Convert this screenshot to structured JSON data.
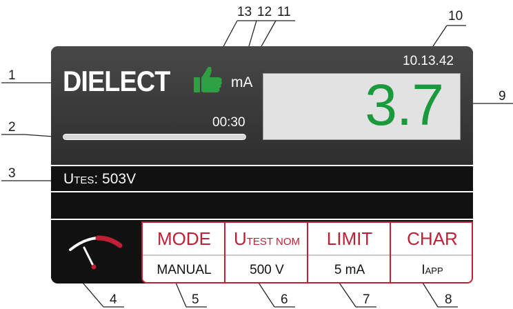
{
  "screen": {
    "title": "DIELECT",
    "clock": "10.13.42",
    "unit": "mA",
    "timer": "00:30",
    "measured_value": "3.7",
    "measured_value_color": "#1a9a3c",
    "parameter_prefix": "U",
    "parameter_sub": "TES",
    "parameter_value": ": 503V",
    "progress_fraction": 1.0,
    "status_icon": "thumbs-up-icon",
    "meter_icon": "analog-meter-icon"
  },
  "softkeys": [
    {
      "label_main": "MODE",
      "label_sub": "",
      "value_main": "MANUAL",
      "value_sub": ""
    },
    {
      "label_main": "U",
      "label_sub": "TEST NOM",
      "value_main": "500 V",
      "value_sub": ""
    },
    {
      "label_main": "LIMIT",
      "label_sub": "",
      "value_main": "5 mA",
      "value_sub": ""
    },
    {
      "label_main": "CHAR",
      "label_sub": "",
      "value_main": "I",
      "value_sub": "APP"
    }
  ],
  "callouts": [
    "1",
    "2",
    "3",
    "4",
    "5",
    "6",
    "7",
    "8",
    "9",
    "10",
    "11",
    "12",
    "13"
  ],
  "colors": {
    "accent": "#c02035",
    "screen_bg": "#111111",
    "panel_bg": "#3a3a3a",
    "value_box": "#e2e2e2",
    "ok_green": "#2ea043"
  }
}
